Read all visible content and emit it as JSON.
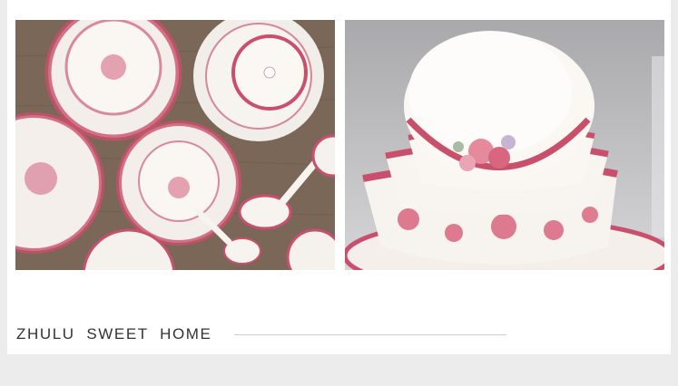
{
  "footer": {
    "tagline": "ZHULU  SWEET  HOME"
  },
  "images": [
    {
      "name": "dinnerware-set-top-view-photo"
    },
    {
      "name": "stacked-bowls-photo"
    }
  ],
  "colors": {
    "page_background": "#ececec",
    "card_background": "#ffffff",
    "tagline_text": "#333333",
    "divider": "#cfcfcf",
    "porcelain_rim": "#c94d6a",
    "porcelain_body": "#f7f3ee",
    "wood_table": "#7a6656"
  }
}
